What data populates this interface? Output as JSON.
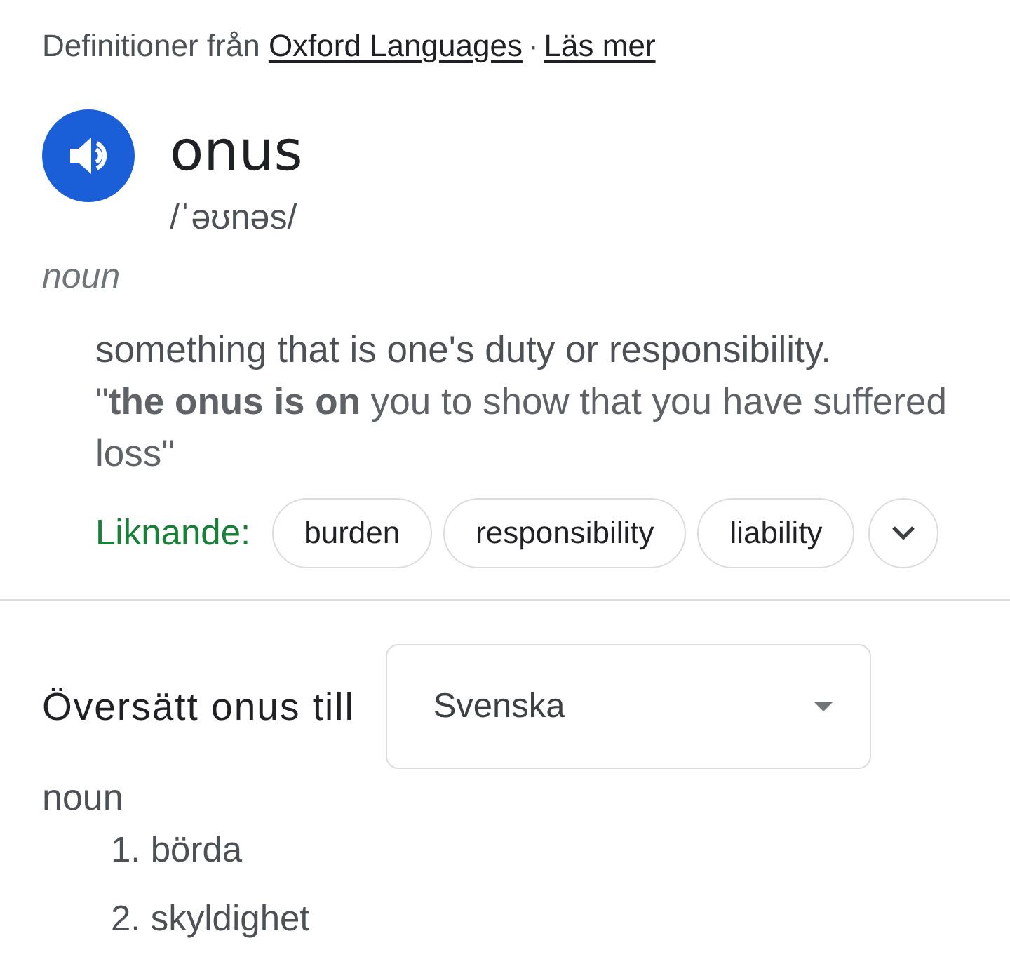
{
  "source": {
    "prefix": "Definitioner från",
    "link": "Oxford Languages",
    "separator": "·",
    "more_link": "Läs mer"
  },
  "entry": {
    "word": "onus",
    "pronunciation": "/ˈəʊnəs/",
    "part_of_speech": "noun"
  },
  "definitions": [
    {
      "text": "something that is one's duty or responsibility.",
      "example": "\"**the onus is on** you to show that you have suffered loss\""
    }
  ],
  "similar": {
    "label": "Liknande:",
    "chips": [
      "burden",
      "responsibility",
      "liability"
    ],
    "expanded": false
  },
  "translate": {
    "label": "Översätt onus till",
    "language": "Svenska",
    "part_of_speech": "noun",
    "translations": [
      {
        "number": "1.",
        "word": "börda"
      },
      {
        "number": "2.",
        "word": "skyldighet"
      }
    ]
  }
}
